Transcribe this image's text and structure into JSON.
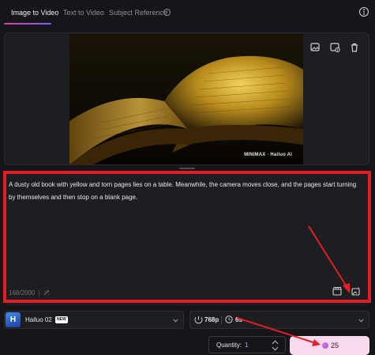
{
  "tabs": [
    {
      "label": "Image to Video",
      "active": true
    },
    {
      "label": "Text to Video",
      "active": false
    },
    {
      "label": "Subject Reference",
      "active": false
    }
  ],
  "image_panel": {
    "watermark": "MINIMAX · Hailuo AI",
    "tools": [
      "replace-image-icon",
      "crop-image-icon",
      "delete-icon"
    ]
  },
  "prompt": {
    "text": "A dusty old book with yellow and torn pages lies on a table. Meanwhile, the camera moves close, and the pages start turning by themselves and then stop on a blank page.",
    "char_count": "168/2000",
    "tools": [
      "clapperboard-icon",
      "magic-image-icon"
    ]
  },
  "model": {
    "name": "Hailuo 02",
    "badge": "NEW",
    "logo": "H"
  },
  "settings": {
    "resolution": "768p",
    "duration": "6s"
  },
  "quantity": {
    "label": "Quantity:",
    "value": "1"
  },
  "generate": {
    "credits": "25"
  },
  "colors": {
    "accent": "#e41d24",
    "button": "#f8d9ee",
    "background": "#151619"
  }
}
